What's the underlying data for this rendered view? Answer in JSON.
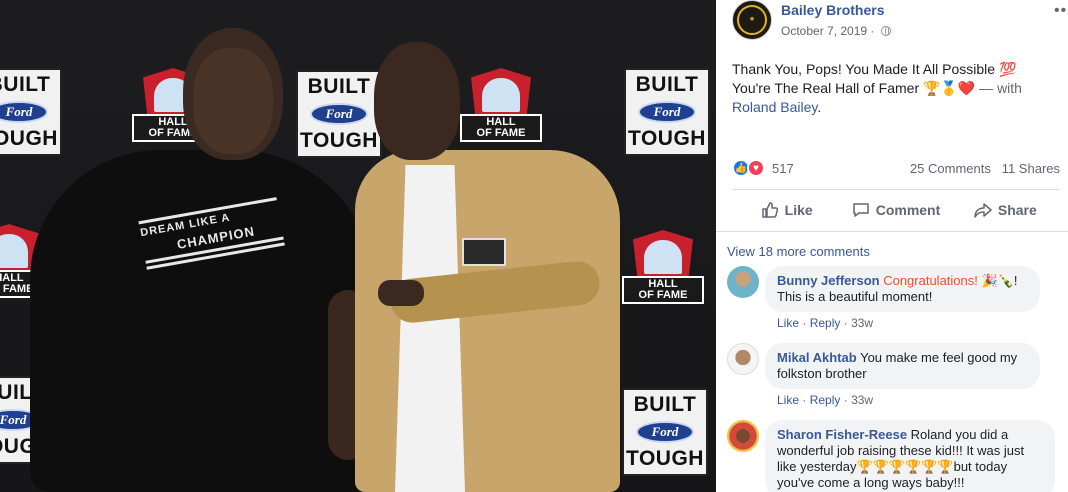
{
  "post": {
    "page_name": "Bailey Brothers",
    "date": "October 7, 2019",
    "privacy_separator": "·",
    "more_label": "•••",
    "text_line1": "Thank You, Pops! You Made It All Possible 💯",
    "text_line2_start": "You're The Real Hall of Famer 🏆🥇❤️",
    "text_with": " — with",
    "tagged_user": "Roland Bailey",
    "tagged_suffix": "."
  },
  "photo": {
    "ford_top": "BUILT",
    "ford_oval": "Ford",
    "ford_bottom": "TOUGH",
    "hof_line1": "HALL",
    "hof_line2": "OF FAME",
    "shirt_line1": "DREAM LIKE A",
    "shirt_line2": "CHAMPION"
  },
  "reactions": {
    "count": "517",
    "comments": "25 Comments",
    "shares": "11 Shares"
  },
  "actions": {
    "like": "Like",
    "comment": "Comment",
    "share": "Share"
  },
  "comments_section": {
    "view_more": "View 18 more comments",
    "items": [
      {
        "author": "Bunny Jefferson",
        "highlight": "Congratulations!",
        "emoji": " 🎉🍾!",
        "text": "This is a beautiful moment!",
        "like": "Like",
        "reply": "Reply",
        "sep": "·",
        "time": "33w"
      },
      {
        "author": "Mikal Akhtab",
        "text": "You make me feel good my folkston brother",
        "like": "Like",
        "reply": "Reply",
        "sep": "·",
        "time": "33w"
      },
      {
        "author": "Sharon Fisher-Reese",
        "text": "Roland you did a wonderful job raising these kid!!! It was just like yesterday🏆🏆🏆🏆🏆🏆but today you've come a long ways baby!!!"
      }
    ]
  },
  "colors": {
    "link_blue": "#385898",
    "meta_gray": "#606770",
    "bubble_bg": "#f2f3f5",
    "like_blue": "#1877f2",
    "love_red": "#f33e58",
    "highlight_orange": "#e9512e"
  }
}
